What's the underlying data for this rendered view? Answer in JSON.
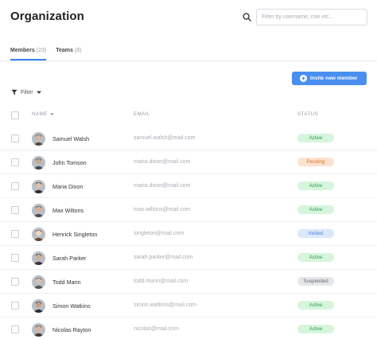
{
  "header": {
    "title": "Organization",
    "search_icon": "search-icon",
    "search_placeholder": "Filter by username, role etc..."
  },
  "tabs": [
    {
      "label": "Members",
      "count": "(23)",
      "active": true
    },
    {
      "label": "Teams",
      "count": "(8)",
      "active": false
    }
  ],
  "toolbar": {
    "invite_label": "Invite new member",
    "invite_icon": "plus-circle-icon",
    "filter_label": "Filter",
    "filter_icon": "funnel-icon"
  },
  "table": {
    "columns": {
      "name": "NAME",
      "email": "EMAIL",
      "status": "STATUS"
    },
    "rows": [
      {
        "name": "Samuel Walsh",
        "email": "samuel.walsh@mail.com",
        "status": "Active"
      },
      {
        "name": "John Tomson",
        "email": "maria.dixon@mail.com",
        "status": "Pending"
      },
      {
        "name": "Maria Dixon",
        "email": "maria.dixon@mail.com",
        "status": "Active"
      },
      {
        "name": "Max Wiltons",
        "email": "max.wiltons@mail.com",
        "status": "Active"
      },
      {
        "name": "Henrick Singleton",
        "email": "singleton@mail.com",
        "status": "Invited"
      },
      {
        "name": "Sarah Parker",
        "email": "sarah.parker@mail.com",
        "status": "Active"
      },
      {
        "name": "Todd Mann",
        "email": "todd.mann@mail.com",
        "status": "Suspended"
      },
      {
        "name": "Simon Watkins",
        "email": "simon.watkins@mail.com",
        "status": "Active"
      },
      {
        "name": "Nicolas Rayton",
        "email": "nicolas@mail.com",
        "status": "Active"
      }
    ]
  },
  "status_colors": {
    "Active": {
      "bg": "#d6f5dd",
      "fg": "#2f9e4f"
    },
    "Pending": {
      "bg": "#fde2cf",
      "fg": "#d9772b"
    },
    "Invited": {
      "bg": "#dbe7fb",
      "fg": "#4a7fd6"
    },
    "Suspended": {
      "bg": "#e4e6e9",
      "fg": "#666b72"
    }
  },
  "colors": {
    "accent": "#4a8ff0"
  }
}
